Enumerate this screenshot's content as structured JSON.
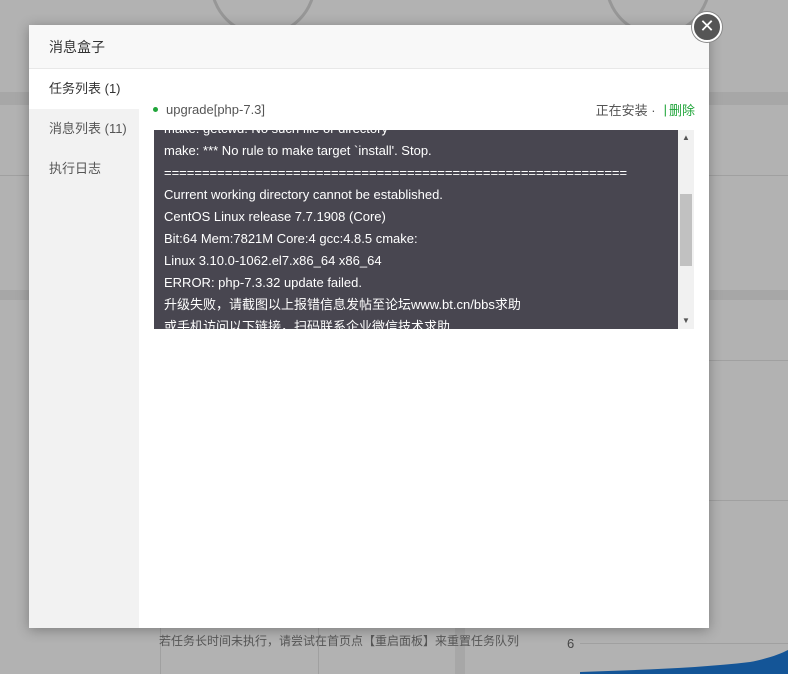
{
  "modal": {
    "title": "消息盒子",
    "close_symbol": "✕"
  },
  "sidebar": {
    "items": [
      {
        "label": "任务列表 (1)"
      },
      {
        "label": "消息列表 (11)"
      },
      {
        "label": "执行日志"
      }
    ]
  },
  "task": {
    "name": "upgrade[php-7.3]",
    "status": "正在安装 ·",
    "separator": "|",
    "delete_label": "删除",
    "log_lines": [
      "make: getcwd: No such file or directory",
      "make: *** No rule to make target `install'. Stop.",
      "=============================================================",
      "Current working directory cannot be established.",
      "CentOS Linux release 7.7.1908 (Core)",
      "Bit:64 Mem:7821M Core:4 gcc:4.8.5 cmake:",
      "Linux 3.10.0-1062.el7.x86_64 x86_64",
      "ERROR: php-7.3.32 update failed.",
      "升级失败，请截图以上报错信息发帖至论坛www.bt.cn/bbs求助",
      "或手机访问以下链接，扫码联系企业微信技术求助"
    ]
  },
  "hint": "若任务长时间未执行，请尝试在首页点【重启面板】来重置任务队列",
  "background": {
    "tick_label": "6"
  },
  "colors": {
    "accent": "#20a53a",
    "log_bg": "#484650"
  },
  "icons": {
    "close": "close-icon",
    "status": "status-dot-icon",
    "scroll_up": "scroll-up-icon",
    "scroll_down": "scroll-down-icon"
  }
}
